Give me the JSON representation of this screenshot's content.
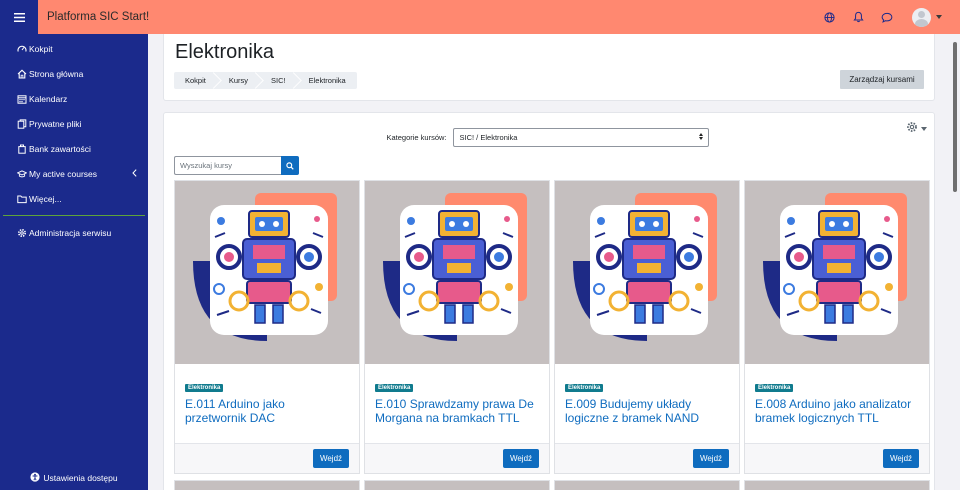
{
  "navbar": {
    "brand": "Platforma SIC Start!",
    "color": "#ff8870",
    "menu_icon": "hamburger-menu-icon",
    "icons": [
      "language-globe-icon",
      "notifications-bell-icon",
      "messages-chat-icon"
    ]
  },
  "sidebar": {
    "color": "#1b2a8c",
    "items": [
      {
        "label": "Kokpit",
        "icon": "dashboard-gauge-icon"
      },
      {
        "label": "Strona główna",
        "icon": "home-icon"
      },
      {
        "label": "Kalendarz",
        "icon": "calendar-icon"
      },
      {
        "label": "Prywatne pliki",
        "icon": "files-icon"
      },
      {
        "label": "Bank zawartości",
        "icon": "content-bank-icon"
      },
      {
        "label": "My active courses",
        "icon": "graduation-cap-icon"
      },
      {
        "label": "Więcej...",
        "icon": "folder-icon"
      }
    ],
    "admin": {
      "label": "Administracja serwisu",
      "icon": "admin-gear-icon"
    },
    "footer": {
      "label": "Ustawienia dostępu",
      "icon": "accessibility-icon"
    }
  },
  "header": {
    "title": "Elektronika",
    "breadcrumb": [
      "Kokpit",
      "Kursy",
      "SIC!",
      "Elektronika"
    ],
    "manage_button": "Zarządzaj kursami"
  },
  "filters": {
    "category_label": "Kategorie kursów:",
    "category_value": "SIC! / Elektronika",
    "search_placeholder": "Wyszukaj kursy"
  },
  "courses": [
    {
      "category": "Elektronika",
      "title": "E.011 Arduino jako przetwornik DAC",
      "button": "Wejdź"
    },
    {
      "category": "Elektronika",
      "title": "E.010 Sprawdzamy prawa De Morgana na bramkach TTL",
      "button": "Wejdź"
    },
    {
      "category": "Elektronika",
      "title": "E.009 Budujemy układy logiczne z bramek NAND",
      "button": "Wejdź"
    },
    {
      "category": "Elektronika",
      "title": "E.008 Arduino jako analizator bramek logicznych TTL",
      "button": "Wejdź"
    }
  ],
  "colors": {
    "primary": "#0f6cbf",
    "badge": "#107b8e",
    "card_image_bg": "#c5bfbf",
    "accent_orange": "#ff8a6e",
    "accent_navy": "#1e2a86"
  }
}
